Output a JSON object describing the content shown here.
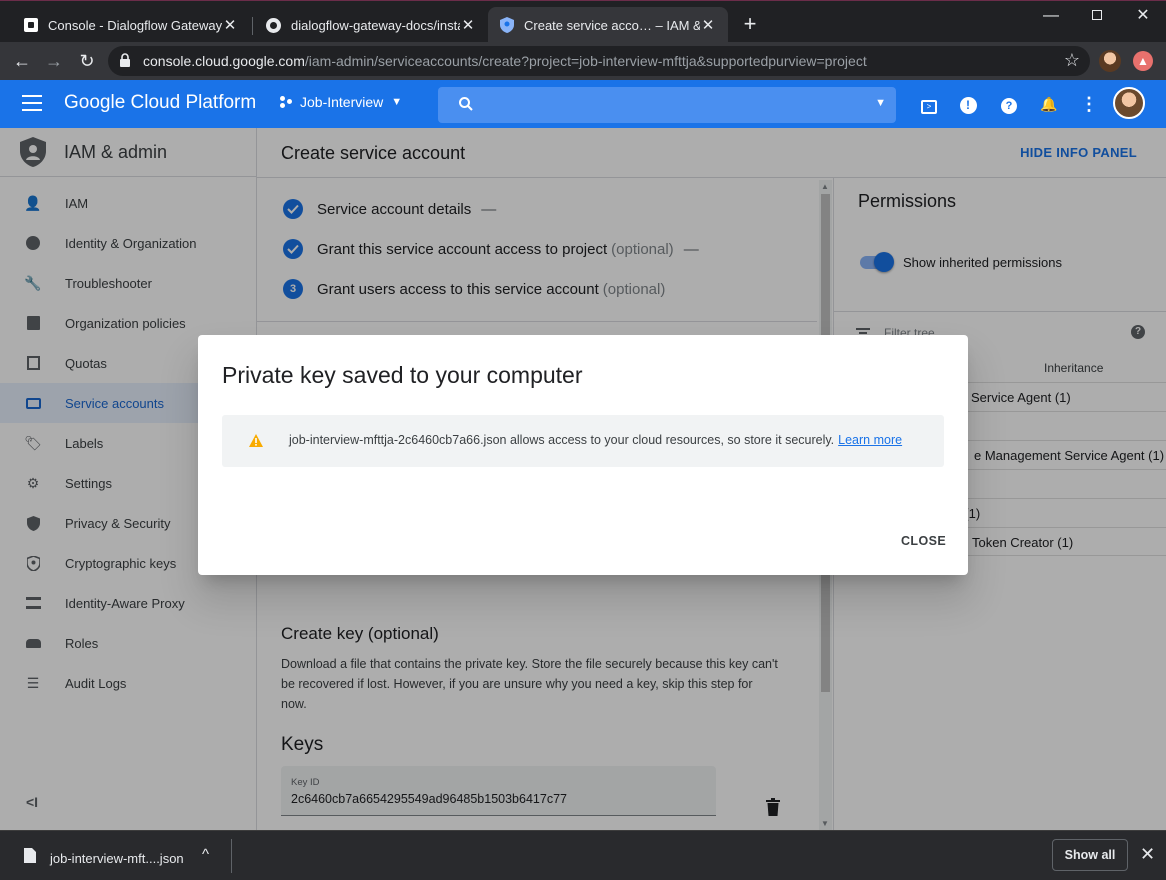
{
  "browser": {
    "tabs": [
      {
        "title": "Console - Dialogflow Gateway",
        "icon": "dialogflow-favicon-icon"
      },
      {
        "title": "dialogflow-gateway-docs/installa",
        "icon": "github-icon"
      },
      {
        "title": "Create service acco… – IAM & ad",
        "icon": "shield-favicon-icon"
      }
    ],
    "url_host": "console.cloud.google.com",
    "url_path": "/iam-admin/serviceaccounts/create?project=job-interview-mfttja&supportedpurview=project"
  },
  "header": {
    "logo": "Google Cloud Platform",
    "project": "Job-Interview"
  },
  "leftnav": {
    "title": "IAM & admin",
    "items": [
      {
        "label": "IAM",
        "icon": "person-add-icon"
      },
      {
        "label": "Identity & Organization",
        "icon": "account-circle-icon"
      },
      {
        "label": "Troubleshooter",
        "icon": "wrench-icon"
      },
      {
        "label": "Organization policies",
        "icon": "policy-doc-icon"
      },
      {
        "label": "Quotas",
        "icon": "quota-icon"
      },
      {
        "label": "Service accounts",
        "icon": "service-account-icon",
        "active": true
      },
      {
        "label": "Labels",
        "icon": "tag-icon"
      },
      {
        "label": "Settings",
        "icon": "gear-icon"
      },
      {
        "label": "Privacy & Security",
        "icon": "shield-icon"
      },
      {
        "label": "Cryptographic keys",
        "icon": "key-shield-icon"
      },
      {
        "label": "Identity-Aware Proxy",
        "icon": "proxy-icon"
      },
      {
        "label": "Roles",
        "icon": "roles-hat-icon"
      },
      {
        "label": "Audit Logs",
        "icon": "list-lines-icon"
      }
    ]
  },
  "main": {
    "title": "Create service account",
    "hide_panel": "HIDE INFO PANEL",
    "steps": [
      {
        "label": "Service account details",
        "optional": "",
        "dash": "—"
      },
      {
        "label": "Grant this service account access to project",
        "optional": "(optional)",
        "dash": "—"
      },
      {
        "number": "3",
        "label": "Grant users access to this service account",
        "optional": "(optional)",
        "dash": ""
      }
    ],
    "key_title": "Create key (optional)",
    "key_desc": "Download a file that contains the private key. Store the file securely because this key can't be recovered if lost. However, if you are unsure why you need a key, skip this step for now.",
    "keys_title": "Keys",
    "keyid_label": "Key ID",
    "keyid_value": "2c6460cb7a6654295549ad96485b1503b6417c77"
  },
  "panel": {
    "title": "Permissions",
    "toggle_label": "Show inherited permissions",
    "filter_placeholder": "Filter tree",
    "col_inheritance": "Inheritance",
    "rows": [
      "Service Agent (1)",
      "e Management Service Agent (1)",
      ")(1)",
      "Token Creator (1)"
    ]
  },
  "dialog": {
    "title": "Private key saved to your computer",
    "message": "job-interview-mfttja-2c6460cb7a66.json allows access to your cloud resources, so store it securely.",
    "learn_more": "Learn more",
    "close": "CLOSE"
  },
  "downloads": {
    "file": "job-interview-mft....json",
    "show_all": "Show all"
  }
}
